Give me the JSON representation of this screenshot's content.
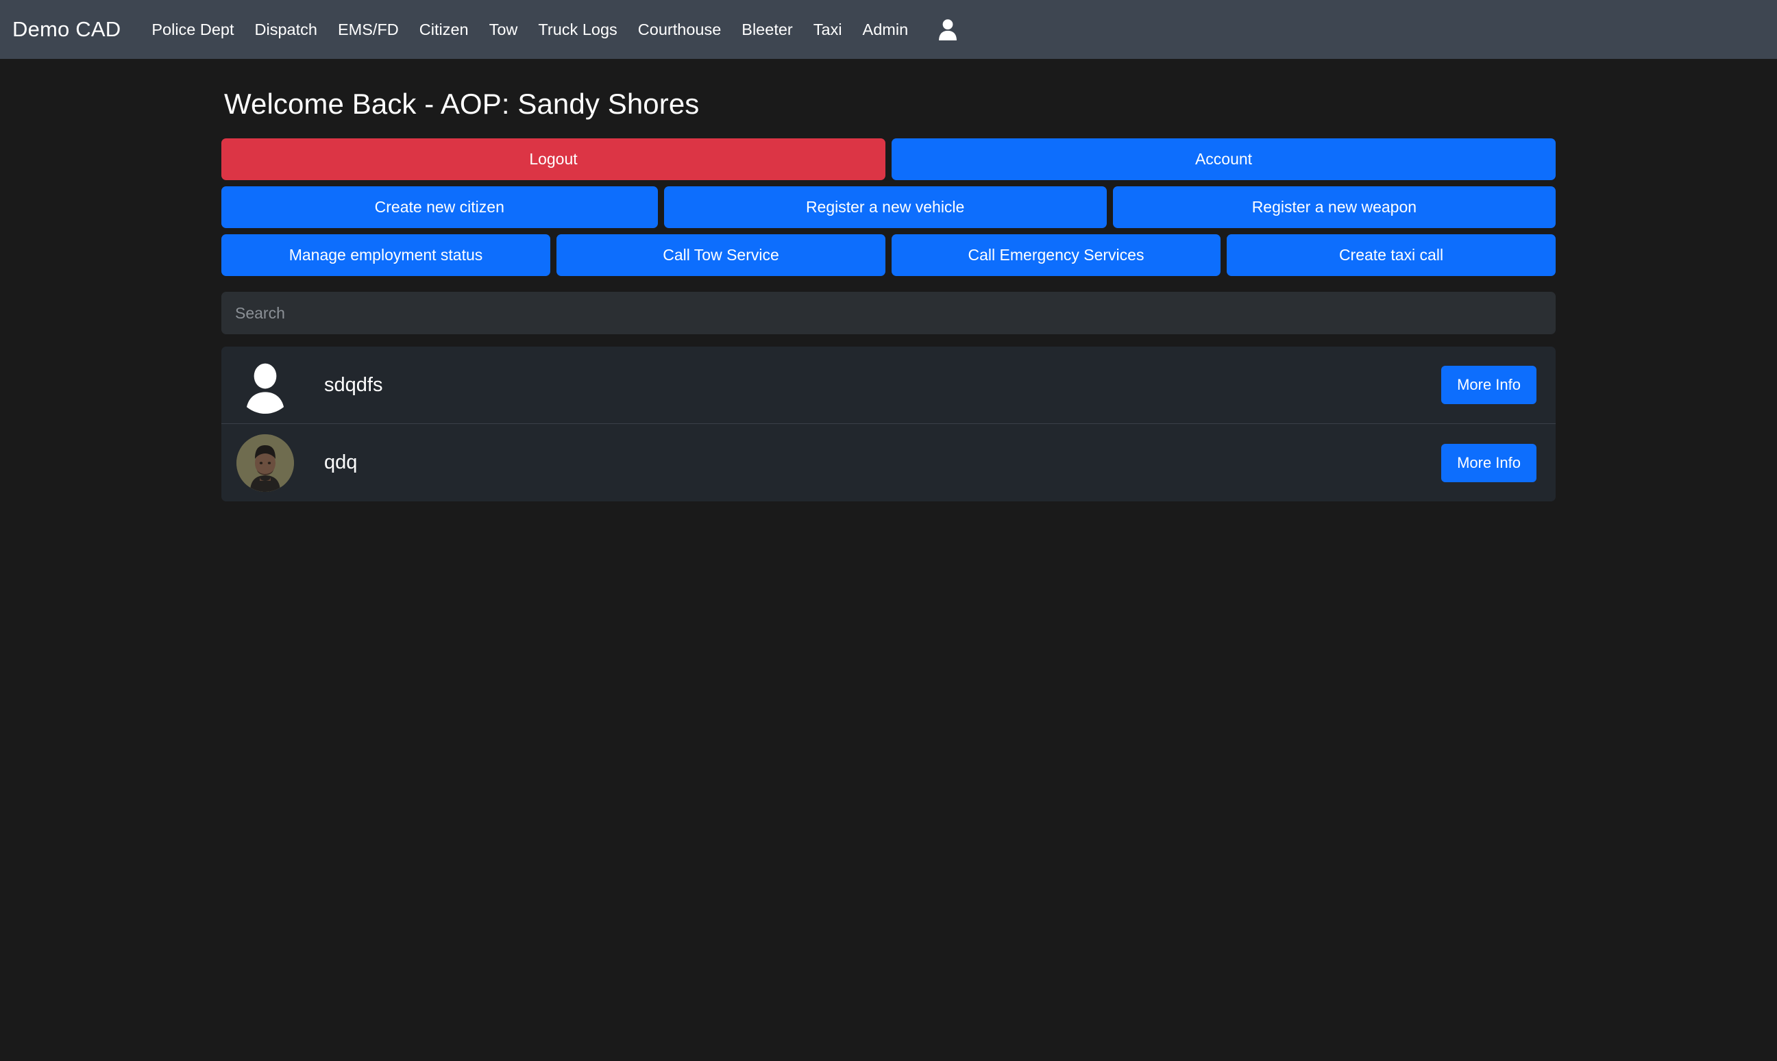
{
  "navbar": {
    "brand": "Demo CAD",
    "links": [
      {
        "label": "Police Dept"
      },
      {
        "label": "Dispatch"
      },
      {
        "label": "EMS/FD"
      },
      {
        "label": "Citizen"
      },
      {
        "label": "Tow"
      },
      {
        "label": "Truck Logs"
      },
      {
        "label": "Courthouse"
      },
      {
        "label": "Bleeter"
      },
      {
        "label": "Taxi"
      },
      {
        "label": "Admin"
      }
    ],
    "user_icon": "user-account-icon",
    "background_color": "#3e4651"
  },
  "main": {
    "title": "Welcome Back - AOP: Sandy Shores",
    "actions": {
      "row1": [
        {
          "label": "Logout",
          "style": "danger",
          "color": "#dc3545"
        },
        {
          "label": "Account",
          "style": "primary",
          "color": "#0d6efd"
        }
      ],
      "row2": [
        {
          "label": "Create new citizen",
          "style": "primary",
          "color": "#0d6efd"
        },
        {
          "label": "Register a new vehicle",
          "style": "primary",
          "color": "#0d6efd"
        },
        {
          "label": "Register a new weapon",
          "style": "primary",
          "color": "#0d6efd"
        }
      ],
      "row3": [
        {
          "label": "Manage employment status",
          "style": "primary",
          "color": "#0d6efd"
        },
        {
          "label": "Call Tow Service",
          "style": "primary",
          "color": "#0d6efd"
        },
        {
          "label": "Call Emergency Services",
          "style": "primary",
          "color": "#0d6efd"
        },
        {
          "label": "Create taxi call",
          "style": "primary",
          "color": "#0d6efd"
        }
      ]
    },
    "search": {
      "placeholder": "Search",
      "value": ""
    },
    "citizens": [
      {
        "name": "sdqdfs",
        "avatar_type": "placeholder",
        "avatar_icon": "default-person-avatar-icon",
        "more_info_label": "More Info"
      },
      {
        "name": "qdq",
        "avatar_type": "photo",
        "avatar_icon": "citizen-portrait-photo",
        "more_info_label": "More Info"
      }
    ]
  },
  "theme": {
    "page_background": "#1a1a1a",
    "panel_background": "#22272d",
    "input_background": "#2b2f33",
    "accent_primary": "#0d6efd",
    "accent_danger": "#dc3545",
    "text_primary": "#ffffff",
    "text_muted": "#8b9096"
  }
}
